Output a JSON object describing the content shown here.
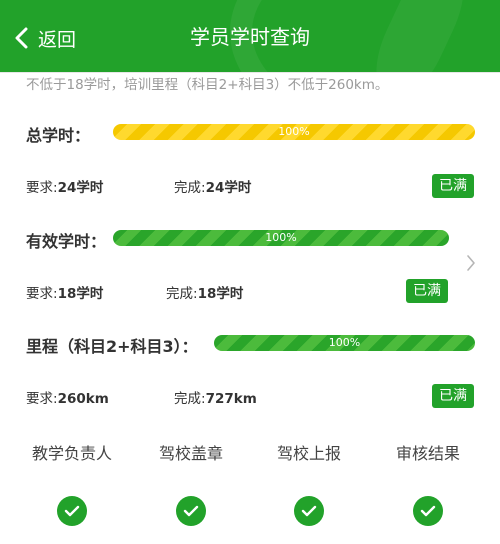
{
  "header": {
    "back_label": "返回",
    "title": "学员学时查询"
  },
  "notice": "不低于18学时，培训里程（科目2+科目3）不低于260km。",
  "total_hours": {
    "label": "总学时：",
    "progress_text": "100%",
    "progress": 1.0,
    "required_prefix": "要求:",
    "required_value": "24学时",
    "completed_prefix": "完成:",
    "completed_value": "24学时",
    "status": "已满"
  },
  "effective_hours": {
    "label": "有效学时：",
    "progress_text": "100%",
    "progress": 1.0,
    "required_prefix": "要求:",
    "required_value": "18学时",
    "completed_prefix": "完成:",
    "completed_value": "18学时",
    "status": "已满"
  },
  "mileage": {
    "label": "里程（科目2+科目3）：",
    "progress_text": "100%",
    "progress": 1.0,
    "required_prefix": "要求:",
    "required_value": "260km",
    "completed_prefix": "完成:",
    "completed_value": "727km",
    "status": "已满"
  },
  "steps": [
    {
      "label": "教学负责人",
      "done": true
    },
    {
      "label": "驾校盖章",
      "done": true
    },
    {
      "label": "驾校上报",
      "done": true
    },
    {
      "label": "审核结果",
      "done": true
    }
  ],
  "colors": {
    "primary_green": "#22a22a",
    "progress_yellow": "#f5c800"
  },
  "icons": {
    "back": "chevron-left-icon",
    "more": "chevron-right-icon",
    "step": "checkmark-icon"
  }
}
